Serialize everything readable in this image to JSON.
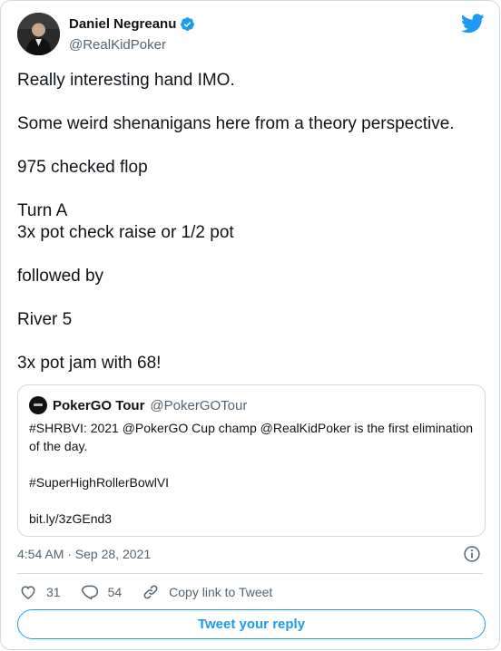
{
  "author": {
    "display_name": "Daniel Negreanu",
    "handle": "@RealKidPoker",
    "verified": true
  },
  "tweet": {
    "paragraphs": [
      "Really interesting hand IMO.",
      "Some weird shenanigans here from a theory perspective.",
      "975 checked flop",
      "Turn A\n3x pot check raise or 1/2 pot",
      "followed by",
      "River 5",
      "3x pot jam with 68!"
    ]
  },
  "quote": {
    "display_name": "PokerGO Tour",
    "handle": "@PokerGOTour",
    "text": "#SHRBVI: 2021 @PokerGO Cup champ @RealKidPoker is the first elimination of the day.",
    "hashtag": "#SuperHighRollerBowlVI",
    "link": "bit.ly/3zGEnd3"
  },
  "meta": {
    "timestamp": "4:54 AM · Sep 28, 2021"
  },
  "actions": {
    "likes": "31",
    "replies": "54",
    "copy_link_label": "Copy link to Tweet"
  },
  "reply_button_label": "Tweet your reply",
  "colors": {
    "accent": "#1d9bf0",
    "text": "#0f1419",
    "secondary": "#536471",
    "border": "#cfd9de"
  }
}
